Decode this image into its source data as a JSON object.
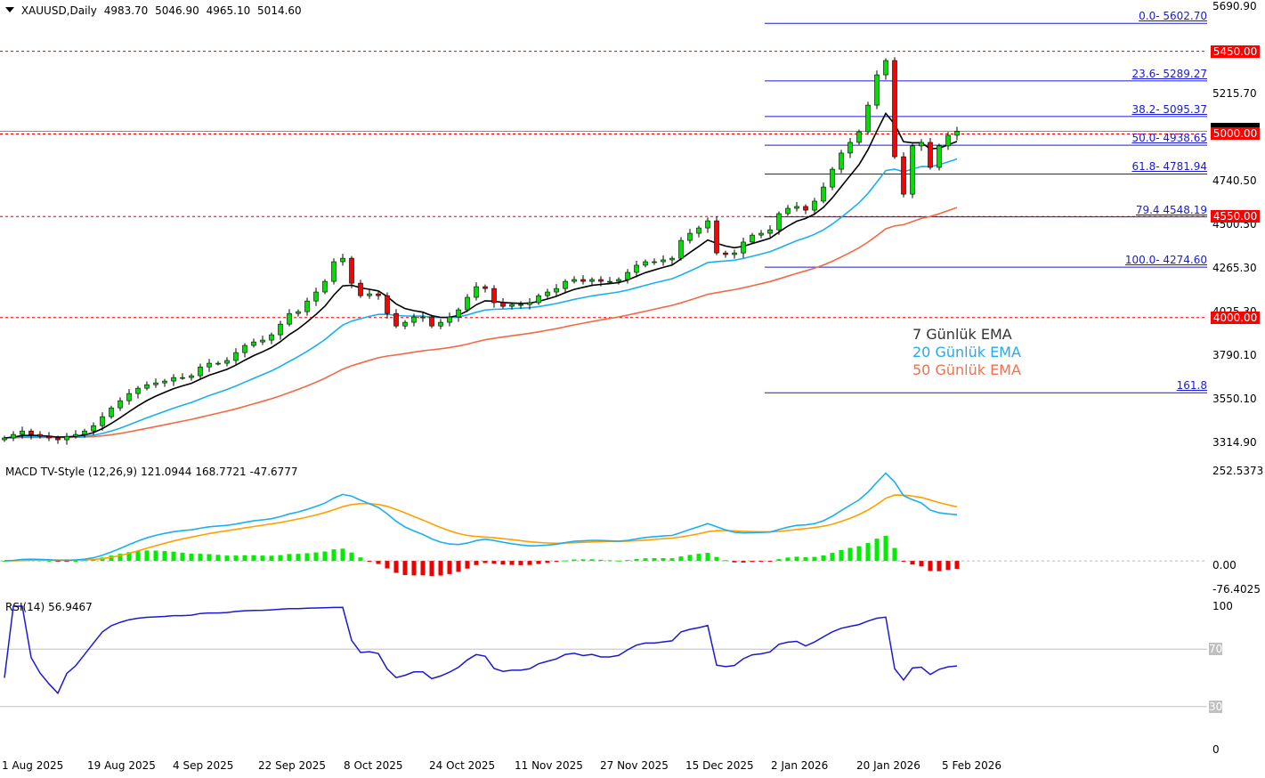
{
  "header": {
    "symbol": "XAUUSD,Daily",
    "open": "4983.70",
    "high": "5046.90",
    "low": "4965.10",
    "close": "5014.60"
  },
  "macd_label": {
    "name": "MACD TV-Style (12,26,9)",
    "macd": "121.0944",
    "signal": "168.7721",
    "hist": "-47.6777"
  },
  "rsi_label": {
    "name": "RSI(14)",
    "value": "56.9467"
  },
  "legend": {
    "ema7": "7 Günlük EMA",
    "ema20": "20 Günlük EMA",
    "ema50": "50 Günlük EMA"
  },
  "colors": {
    "bull": "#00e000",
    "bear": "#ff0000",
    "ema7": "#000000",
    "ema20": "#1ab0f0",
    "ema50": "#f26a43",
    "macd": "#1ab0f0",
    "signal": "#ffa000",
    "rsi": "#1a1ad6",
    "fib": "#1a1ad6",
    "level": "#e00000"
  },
  "chart_data": {
    "type": "candlestick",
    "title": "XAUUSD, Daily",
    "price_axis": {
      "range": [
        3314.9,
        5690.9
      ],
      "ticks": [
        "5690.90",
        "5215.70",
        "4740.50",
        "4500.50",
        "4265.30",
        "4025.30",
        "3790.10",
        "3550.10",
        "3314.90"
      ]
    },
    "x_tick_labels": [
      "1 Aug 2025",
      "19 Aug 2025",
      "4 Sep 2025",
      "22 Sep 2025",
      "8 Oct 2025",
      "24 Oct 2025",
      "11 Nov 2025",
      "27 Nov 2025",
      "15 Dec 2025",
      "2 Jan 2026",
      "20 Jan 2026",
      "5 Feb 2026"
    ],
    "closes": [
      3344,
      3363,
      3382,
      3363,
      3353,
      3344,
      3334,
      3353,
      3363,
      3382,
      3411,
      3460,
      3508,
      3547,
      3586,
      3615,
      3634,
      3644,
      3654,
      3673,
      3673,
      3683,
      3731,
      3751,
      3751,
      3766,
      3809,
      3848,
      3867,
      3877,
      3906,
      3964,
      4022,
      4032,
      4090,
      4139,
      4197,
      4304,
      4323,
      4187,
      4119,
      4129,
      4119,
      4022,
      3954,
      3974,
      4003,
      4003,
      3954,
      3974,
      4003,
      4042,
      4110,
      4168,
      4158,
      4081,
      4061,
      4071,
      4071,
      4081,
      4119,
      4139,
      4158,
      4197,
      4207,
      4197,
      4207,
      4197,
      4197,
      4207,
      4246,
      4285,
      4304,
      4304,
      4314,
      4323,
      4420,
      4459,
      4488,
      4527,
      4352,
      4343,
      4352,
      4411,
      4449,
      4459,
      4478,
      4566,
      4595,
      4605,
      4585,
      4634,
      4711,
      4808,
      4896,
      4954,
      5012,
      5157,
      5322,
      5400,
      4876,
      4672,
      4935,
      4954,
      4818,
      4935,
      4993,
      5014.6
    ],
    "horizontal_levels": [
      {
        "label": "5450.00",
        "value": 5450
      },
      {
        "label": "5000.00",
        "value": 5000
      },
      {
        "label": "4550.00",
        "value": 4550
      },
      {
        "label": "4000.00",
        "value": 4000
      }
    ],
    "current_price": 5014.6,
    "fibonacci": [
      {
        "label": "0.0- 5602.70",
        "value": 5602.7
      },
      {
        "label": "23.6- 5289.27",
        "value": 5289.27
      },
      {
        "label": "38.2- 5095.37",
        "value": 5095.37
      },
      {
        "label": "50.0- 4938.65",
        "value": 4938.65
      },
      {
        "label": "61.8- 4781.94",
        "value": 4781.94
      },
      {
        "label": "79.4 4548.19",
        "value": 4548.19
      },
      {
        "label": "100.0- 4274.60",
        "value": 4274.6
      },
      {
        "label": "161.8",
        "value": 3590
      }
    ],
    "ema_periods": [
      7,
      20,
      50
    ],
    "macd": {
      "params": [
        12,
        26,
        9
      ],
      "axis_ticks": [
        "252.5373",
        "0.00",
        "-76.4025"
      ],
      "range": [
        -76.4025,
        252.5373
      ]
    },
    "rsi": {
      "period": 14,
      "axis_ticks": [
        "100",
        "70",
        "30",
        "0"
      ],
      "levels": [
        70,
        30
      ]
    }
  }
}
